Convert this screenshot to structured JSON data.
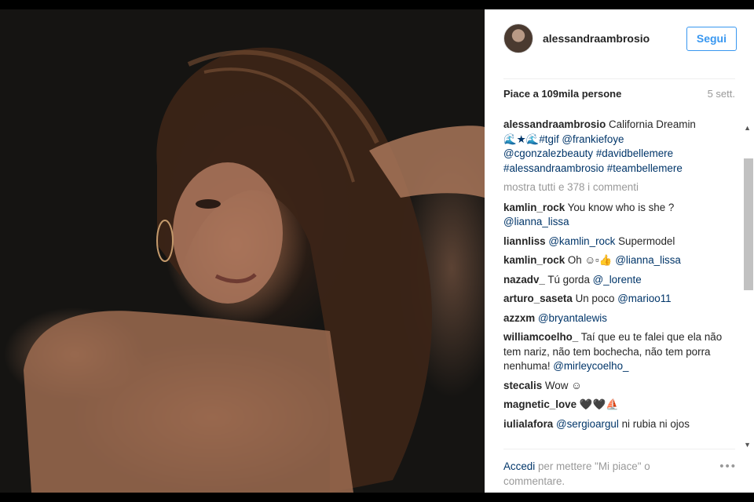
{
  "post": {
    "username": "alessandraambrosio",
    "follow_label": "Segui",
    "likes": "Piace a 109mila persone",
    "date": "5 sett.",
    "caption": {
      "user": "alessandraambrosio",
      "text": "California Dreamin",
      "tags_line1": "🌊★🌊#tgif @frankiefoye",
      "tags_line2": "@cgonzalezbeauty #davidbellemere",
      "tags_line3": "#alessandraambrosio #teambellemere"
    },
    "show_all": "mostra tutti e 378 i commenti",
    "comments": [
      {
        "user": "kamlin_rock",
        "text": "You know who is she ?",
        "tag": "@lianna_lissa"
      },
      {
        "user": "liannliss",
        "tag": "@kamlin_rock",
        "text": "Supermodel"
      },
      {
        "user": "kamlin_rock",
        "text": "Oh ☺▫👍",
        "tag": "@lianna_lissa"
      },
      {
        "user": "nazadv_",
        "text": "Tú gorda",
        "tag": "@_lorente"
      },
      {
        "user": "arturo_saseta",
        "text": "Un poco",
        "tag": "@marioo11"
      },
      {
        "user": "azzxm",
        "tag": "@bryantalewis"
      },
      {
        "user": "williamcoelho_",
        "text": "Taí que eu te falei que ela não tem nariz, não tem bochecha, não tem porra nenhuma!",
        "tag": "@mirleycoelho_"
      },
      {
        "user": "stecalis",
        "text": "Wow ☺"
      },
      {
        "user": "magnetic_love",
        "text": "🖤🖤⛵"
      },
      {
        "user": "iuliala​fora",
        "tag": "@sergioargul",
        "text": "ni rubia ni ojos"
      }
    ],
    "footer": {
      "login": "Accedi",
      "rest": "per mettere \"Mi piace\" o commentare.",
      "more_icon": "•••"
    }
  },
  "colors": {
    "link": "#003569",
    "follow": "#3897f0",
    "muted": "#999999"
  }
}
